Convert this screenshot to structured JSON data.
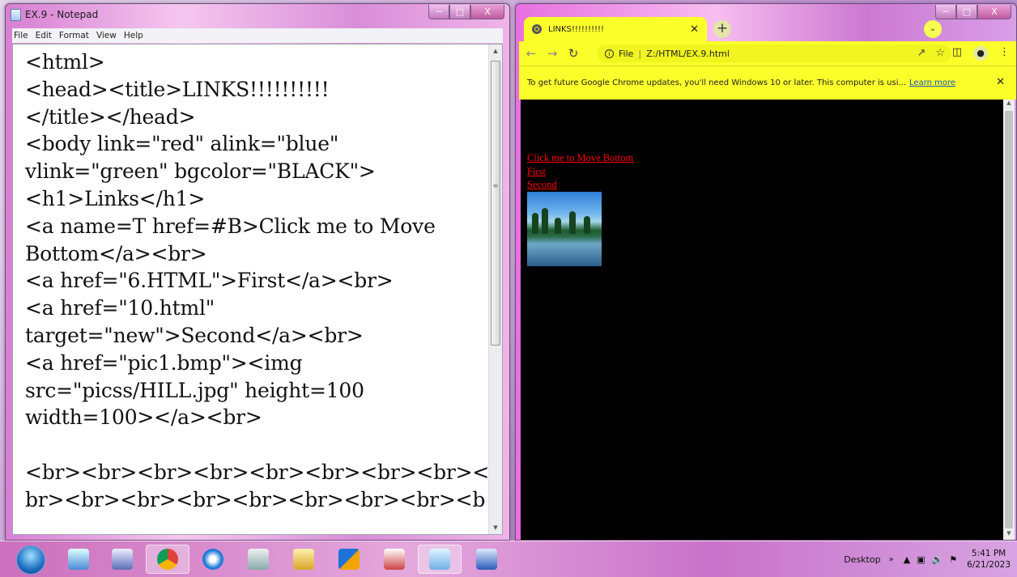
{
  "notepad": {
    "title": "EX.9 - Notepad",
    "menu": [
      "File",
      "Edit",
      "Format",
      "View",
      "Help"
    ],
    "lines": [
      "<html>",
      "<head><title>LINKS!!!!!!!!!!",
      "</title></head>",
      "<body link=\"red\" alink=\"blue\"",
      "vlink=\"green\" bgcolor=\"BLACK\">",
      "<h1>Links</h1>",
      "<a name=T href=#B>Click me to Move",
      "Bottom</a><br>",
      "<a href=\"6.HTML\">First</a><br>",
      "<a href=\"10.html\"",
      "target=\"new\">Second</a><br>",
      "<a href=\"pic1.bmp\"><img",
      "src=\"picss/HILL.jpg\" height=100",
      "width=100></a><br>",
      "",
      "<br><br><br><br><br><br><br><br><",
      "br><br><br><br><br><br><br><br><b"
    ]
  },
  "chrome": {
    "tab_title": "LINKS!!!!!!!!!!",
    "address_prefix": "File",
    "address_url": "Z:/HTML/EX.9.html",
    "infobar_text": "To get future Google Chrome updates, you'll need Windows 10 or later. This computer is usi...",
    "infobar_link": "Learn more",
    "page_links": [
      "Click me to Move Bottom",
      "First",
      "Second"
    ]
  },
  "taskbar": {
    "desktop_label": "Desktop",
    "time": "5:41 PM",
    "date": "6/21/2023"
  },
  "colors": {
    "infobar_bg": "#fbff2a",
    "page_bg": "#000000",
    "link_color": "#ff0000"
  }
}
